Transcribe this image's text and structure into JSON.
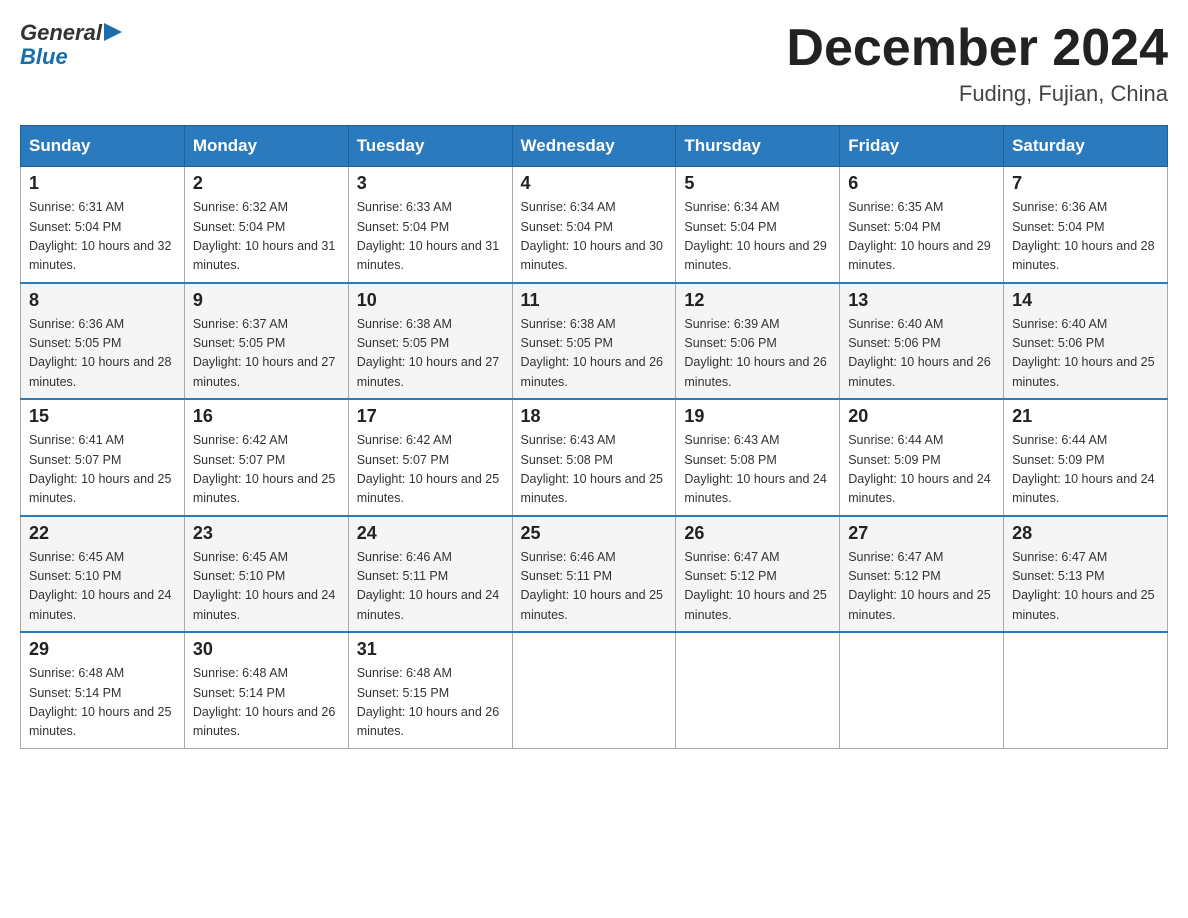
{
  "header": {
    "logo": {
      "general": "General",
      "blue": "Blue"
    },
    "title": "December 2024",
    "location": "Fuding, Fujian, China"
  },
  "weekdays": [
    "Sunday",
    "Monday",
    "Tuesday",
    "Wednesday",
    "Thursday",
    "Friday",
    "Saturday"
  ],
  "weeks": [
    [
      {
        "day": "1",
        "sunrise": "6:31 AM",
        "sunset": "5:04 PM",
        "daylight": "10 hours and 32 minutes."
      },
      {
        "day": "2",
        "sunrise": "6:32 AM",
        "sunset": "5:04 PM",
        "daylight": "10 hours and 31 minutes."
      },
      {
        "day": "3",
        "sunrise": "6:33 AM",
        "sunset": "5:04 PM",
        "daylight": "10 hours and 31 minutes."
      },
      {
        "day": "4",
        "sunrise": "6:34 AM",
        "sunset": "5:04 PM",
        "daylight": "10 hours and 30 minutes."
      },
      {
        "day": "5",
        "sunrise": "6:34 AM",
        "sunset": "5:04 PM",
        "daylight": "10 hours and 29 minutes."
      },
      {
        "day": "6",
        "sunrise": "6:35 AM",
        "sunset": "5:04 PM",
        "daylight": "10 hours and 29 minutes."
      },
      {
        "day": "7",
        "sunrise": "6:36 AM",
        "sunset": "5:04 PM",
        "daylight": "10 hours and 28 minutes."
      }
    ],
    [
      {
        "day": "8",
        "sunrise": "6:36 AM",
        "sunset": "5:05 PM",
        "daylight": "10 hours and 28 minutes."
      },
      {
        "day": "9",
        "sunrise": "6:37 AM",
        "sunset": "5:05 PM",
        "daylight": "10 hours and 27 minutes."
      },
      {
        "day": "10",
        "sunrise": "6:38 AM",
        "sunset": "5:05 PM",
        "daylight": "10 hours and 27 minutes."
      },
      {
        "day": "11",
        "sunrise": "6:38 AM",
        "sunset": "5:05 PM",
        "daylight": "10 hours and 26 minutes."
      },
      {
        "day": "12",
        "sunrise": "6:39 AM",
        "sunset": "5:06 PM",
        "daylight": "10 hours and 26 minutes."
      },
      {
        "day": "13",
        "sunrise": "6:40 AM",
        "sunset": "5:06 PM",
        "daylight": "10 hours and 26 minutes."
      },
      {
        "day": "14",
        "sunrise": "6:40 AM",
        "sunset": "5:06 PM",
        "daylight": "10 hours and 25 minutes."
      }
    ],
    [
      {
        "day": "15",
        "sunrise": "6:41 AM",
        "sunset": "5:07 PM",
        "daylight": "10 hours and 25 minutes."
      },
      {
        "day": "16",
        "sunrise": "6:42 AM",
        "sunset": "5:07 PM",
        "daylight": "10 hours and 25 minutes."
      },
      {
        "day": "17",
        "sunrise": "6:42 AM",
        "sunset": "5:07 PM",
        "daylight": "10 hours and 25 minutes."
      },
      {
        "day": "18",
        "sunrise": "6:43 AM",
        "sunset": "5:08 PM",
        "daylight": "10 hours and 25 minutes."
      },
      {
        "day": "19",
        "sunrise": "6:43 AM",
        "sunset": "5:08 PM",
        "daylight": "10 hours and 24 minutes."
      },
      {
        "day": "20",
        "sunrise": "6:44 AM",
        "sunset": "5:09 PM",
        "daylight": "10 hours and 24 minutes."
      },
      {
        "day": "21",
        "sunrise": "6:44 AM",
        "sunset": "5:09 PM",
        "daylight": "10 hours and 24 minutes."
      }
    ],
    [
      {
        "day": "22",
        "sunrise": "6:45 AM",
        "sunset": "5:10 PM",
        "daylight": "10 hours and 24 minutes."
      },
      {
        "day": "23",
        "sunrise": "6:45 AM",
        "sunset": "5:10 PM",
        "daylight": "10 hours and 24 minutes."
      },
      {
        "day": "24",
        "sunrise": "6:46 AM",
        "sunset": "5:11 PM",
        "daylight": "10 hours and 24 minutes."
      },
      {
        "day": "25",
        "sunrise": "6:46 AM",
        "sunset": "5:11 PM",
        "daylight": "10 hours and 25 minutes."
      },
      {
        "day": "26",
        "sunrise": "6:47 AM",
        "sunset": "5:12 PM",
        "daylight": "10 hours and 25 minutes."
      },
      {
        "day": "27",
        "sunrise": "6:47 AM",
        "sunset": "5:12 PM",
        "daylight": "10 hours and 25 minutes."
      },
      {
        "day": "28",
        "sunrise": "6:47 AM",
        "sunset": "5:13 PM",
        "daylight": "10 hours and 25 minutes."
      }
    ],
    [
      {
        "day": "29",
        "sunrise": "6:48 AM",
        "sunset": "5:14 PM",
        "daylight": "10 hours and 25 minutes."
      },
      {
        "day": "30",
        "sunrise": "6:48 AM",
        "sunset": "5:14 PM",
        "daylight": "10 hours and 26 minutes."
      },
      {
        "day": "31",
        "sunrise": "6:48 AM",
        "sunset": "5:15 PM",
        "daylight": "10 hours and 26 minutes."
      },
      null,
      null,
      null,
      null
    ]
  ]
}
